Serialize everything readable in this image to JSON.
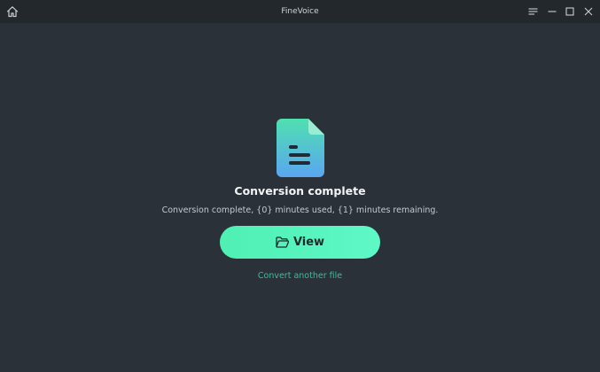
{
  "window": {
    "title": "FineVoice"
  },
  "titlebar_icons": {
    "home": "home-icon",
    "menu": "menu-icon",
    "minimize": "minimize-icon",
    "maximize": "maximize-icon",
    "close": "close-icon"
  },
  "result": {
    "icon": "document-icon",
    "heading": "Conversion complete",
    "message": "Conversion complete, {0} minutes used, {1} minutes remaining."
  },
  "actions": {
    "view_label": "View",
    "view_icon": "folder-open-icon",
    "convert_another_label": "Convert another file"
  },
  "colors": {
    "background": "#2b3138",
    "titlebar": "#23282d",
    "accent": "#5ef8c7",
    "link": "#49b79a",
    "icon_gradient_top": "#4fe0b0",
    "icon_gradient_bottom": "#5aa6f0"
  }
}
